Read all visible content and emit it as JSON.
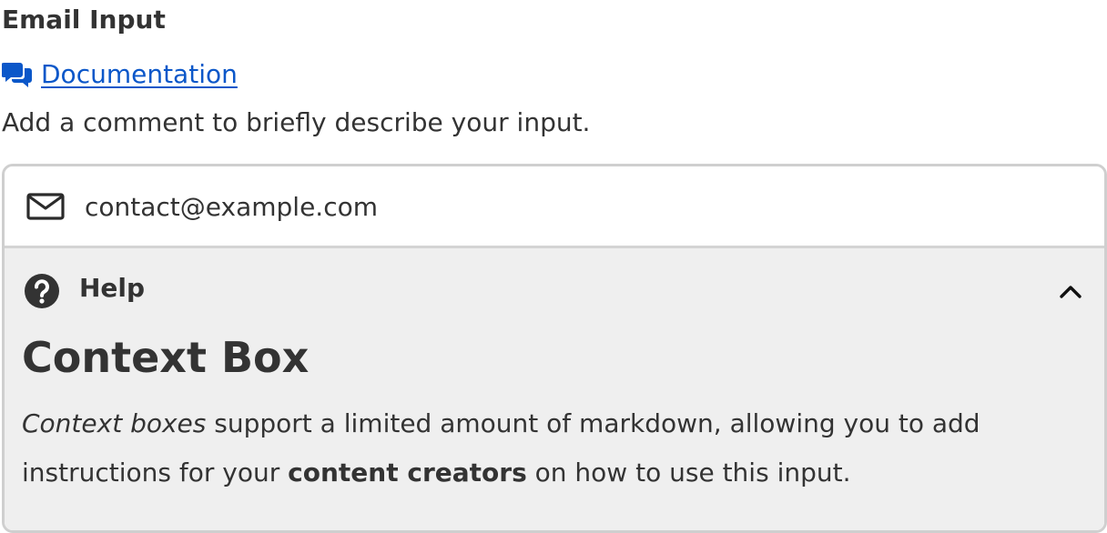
{
  "field": {
    "label": "Email Input",
    "documentation_link": "Documentation",
    "description": "Add a comment to briefly describe your input."
  },
  "input": {
    "value": "contact@example.com",
    "icon": "mail-icon"
  },
  "help": {
    "title": "Help",
    "icon": "question-circle-icon",
    "toggle_icon": "chevron-up-icon",
    "heading": "Context Box",
    "body": {
      "emphasis": "Context boxes",
      "part1": " support a limited amount of markdown, allowing you to add instructions for your ",
      "strong": "content creators",
      "part2": " on how to use this input."
    }
  },
  "colors": {
    "link": "#0b57c9",
    "text": "#333333",
    "border": "#cfcfcf",
    "help_background": "#efefef"
  }
}
